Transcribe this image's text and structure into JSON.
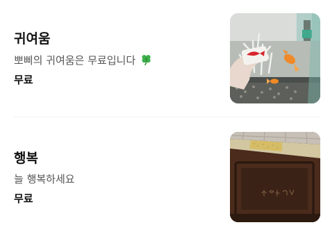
{
  "products": [
    {
      "title": "귀여움",
      "description": "뽀삐의 귀여움은 무료입니다",
      "description_icon": "four-leaf-clover-icon",
      "price": "무료",
      "image": "fish-aquarium-photo"
    },
    {
      "title": "행복",
      "description": "늘 행복하세요",
      "price": "무료",
      "image": "wooden-cabinet-photo"
    }
  ],
  "colors": {
    "title": "#111111",
    "description": "#555555",
    "divider": "#f1f1f1",
    "clover": "#3cb04a"
  }
}
